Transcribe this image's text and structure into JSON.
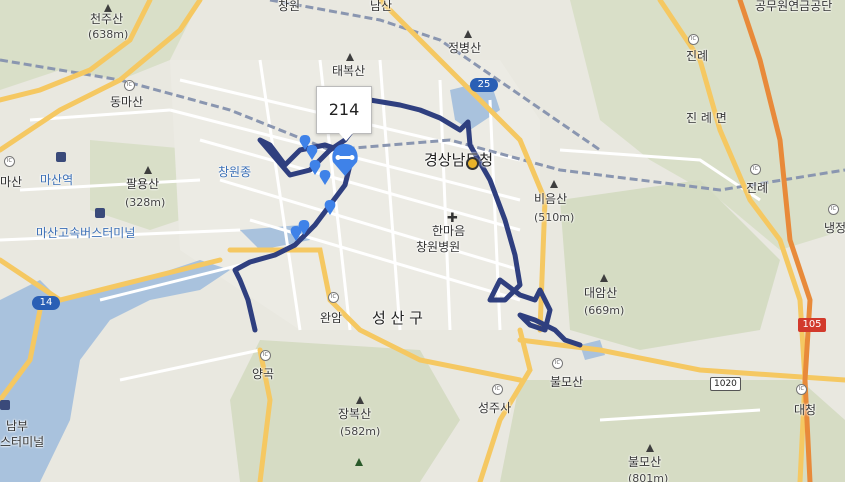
{
  "map": {
    "popup_value": "214",
    "colors": {
      "background": "#e9e8e0",
      "park": "#d9dfc8",
      "water": "#a9c2dd",
      "road_major": "#f5c862",
      "road_minor": "#ffffff",
      "route": "#2f3f7f",
      "marker": "#3f82e8"
    },
    "labels": {
      "cheonjusan": "천주산",
      "cheonjusan_elev": "(638m)",
      "dongmasan": "동마산",
      "masanyeok": "마산역",
      "mamasan": "마산",
      "palyongsan": "팔용산",
      "palyongsan_elev": "(328m)",
      "masan_terminal": "마산고속버스터미널",
      "changwonjong": "창원종",
      "taebuksan": "태복산",
      "jeongbyeongsan": "정병산",
      "namsan": "남산",
      "changwon_top": "창원",
      "gyeongsang_office": "경상남도청",
      "hanmaeum_1": "한마음",
      "hanmaeum_2": "창원병원",
      "bieumsan": "비음산",
      "bieumsan_elev": "(510m)",
      "daeamsan": "대암산",
      "daeamsan_elev": "(669m)",
      "jinrye_top": "진례",
      "jinrye_myeon": "진 례 면",
      "jinrye_ic": "진례",
      "naengjeong": "냉정",
      "gongmu": "공무원연금공단",
      "wanam": "완암",
      "seongsan_gu": "성 산 구",
      "yanggok": "양곡",
      "seongjusa": "성주사",
      "bulmosan_ic": "불모산",
      "bulmosan": "불모산",
      "bulmosan_elev": "(801m)",
      "jangboksan": "장복산",
      "jangboksan_elev": "(582m)",
      "daecheong": "대청",
      "nambu_1": "남부",
      "nambu_2": "스터미널"
    },
    "shields": {
      "route25": "25",
      "route14": "14",
      "route1020": "1020",
      "route105": "105"
    },
    "icon_names": [
      "mountain-icon",
      "ic-icon",
      "marker-icon",
      "station-icon",
      "hospital-icon",
      "government-icon"
    ]
  }
}
